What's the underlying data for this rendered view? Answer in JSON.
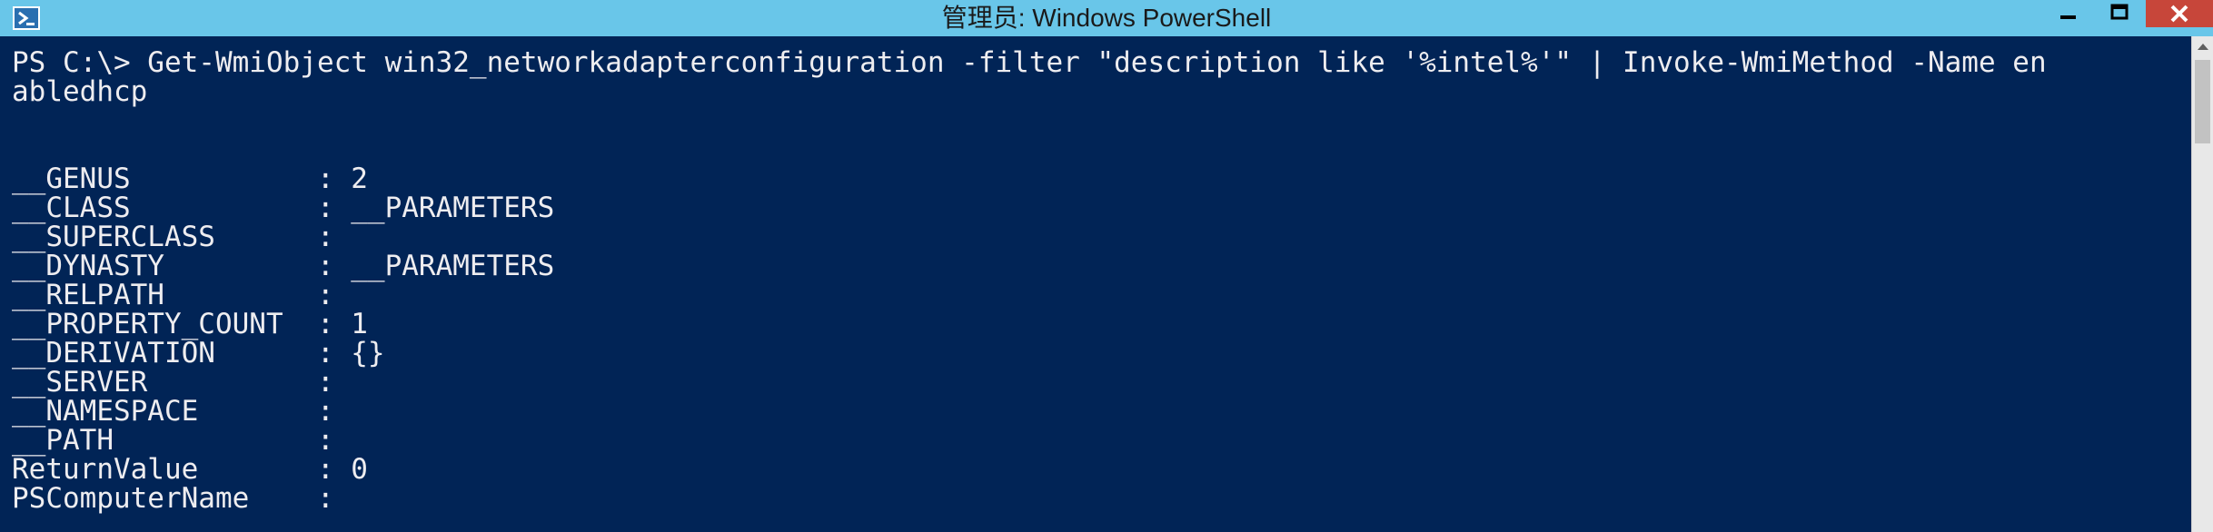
{
  "window": {
    "title": "管理员: Windows PowerShell"
  },
  "icons": {
    "app": "powershell-icon",
    "minimize": "minimize-icon",
    "maximize": "maximize-icon",
    "close": "close-icon",
    "scroll_up": "scroll-up-arrow-icon"
  },
  "colors": {
    "titlebar": "#69c6e9",
    "console_bg": "#012456",
    "console_text": "#eeedf0",
    "close_button": "#c7463a"
  },
  "console": {
    "lines": [
      "PS C:\\> Get-WmiObject win32_networkadapterconfiguration -filter \"description like '%intel%'\" | Invoke-WmiMethod -Name en",
      "abledhcp",
      "",
      "",
      "__GENUS           : 2",
      "__CLASS           : __PARAMETERS",
      "__SUPERCLASS      :",
      "__DYNASTY         : __PARAMETERS",
      "__RELPATH         :",
      "__PROPERTY_COUNT  : 1",
      "__DERIVATION      : {}",
      "__SERVER          :",
      "__NAMESPACE       :",
      "__PATH            :",
      "ReturnValue       : 0",
      "PSComputerName    :"
    ]
  }
}
